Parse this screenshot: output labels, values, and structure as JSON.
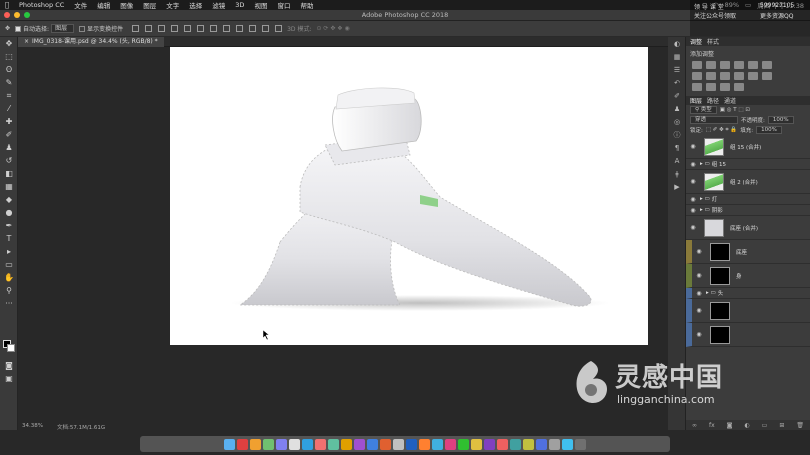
{
  "menubar": {
    "app": "Photoshop CC",
    "items": [
      "文件",
      "编辑",
      "图像",
      "图层",
      "文字",
      "选择",
      "滤镜",
      "3D",
      "视图",
      "窗口",
      "帮助"
    ],
    "battery": "89%",
    "clock": "周四 下午11:38"
  },
  "window": {
    "title": "Adobe Photoshop CC 2018"
  },
  "options": {
    "auto_select_label": "自动选择:",
    "auto_select_value": "图层",
    "show_transform_label": "显示变换控件",
    "mode_3d": "3D 模式:"
  },
  "document": {
    "tab_title": "IMG_0318-课用.psd @ 34.4% (头, RGB/8) *",
    "zoom": "34.38%",
    "doc_size": "文档:57.1M/1.61G"
  },
  "panels": {
    "adjust_tabs": [
      "调整",
      "样式"
    ],
    "add_adjustment": "添加调整",
    "layer_tabs": [
      "图层",
      "路径",
      "通道"
    ],
    "kind_filter": "类型",
    "blend_mode": "穿透",
    "opacity_label": "不透明度:",
    "opacity_value": "100%",
    "lock_label": "锁定:",
    "fill_label": "填充:",
    "fill_value": "100%"
  },
  "layers": [
    {
      "name": "组 15 (合并)",
      "kind": "thumb",
      "thumb": "green"
    },
    {
      "name": "组 15",
      "kind": "group"
    },
    {
      "name": "组 2 (合并)",
      "kind": "thumb",
      "thumb": "green"
    },
    {
      "name": "灯",
      "kind": "group"
    },
    {
      "name": "阴影",
      "kind": "group"
    },
    {
      "name": "底座 (合并)",
      "kind": "thumb",
      "thumb": "white"
    },
    {
      "name": "底座",
      "kind": "mask",
      "tag": "#8a7a3a"
    },
    {
      "name": "身",
      "kind": "mask",
      "tag": "#6a7a3a"
    },
    {
      "name": "头",
      "kind": "group",
      "tag": "#4a6a9a"
    },
    {
      "name": "",
      "kind": "mask",
      "tag": "#4a6a9a"
    },
    {
      "name": "",
      "kind": "mask",
      "tag": "#4a6a9a"
    }
  ],
  "overlay": {
    "line1": "领 导 课 堂",
    "line2": "关注公众号领取",
    "qq1": "599927105",
    "qq2": "更多资源QQ"
  },
  "watermark": {
    "title": "灵感中国",
    "url": "lingganchina.com"
  },
  "dock": {
    "icon_colors": [
      "#5ab0f0",
      "#e04040",
      "#f0a030",
      "#70c070",
      "#8080f0",
      "#e0e0e0",
      "#30a0e0",
      "#f07070",
      "#60c0a0",
      "#e0a000",
      "#a050d0",
      "#4080e0",
      "#e06030",
      "#c0c0c0",
      "#2060c0",
      "#ff8030",
      "#40b0e0",
      "#e04080",
      "#30c030",
      "#e0c040",
      "#8040c0",
      "#f06060",
      "#40a0a0",
      "#c0c040",
      "#5070e0",
      "#a0a0a0",
      "#40c0f0",
      "#707070"
    ]
  }
}
